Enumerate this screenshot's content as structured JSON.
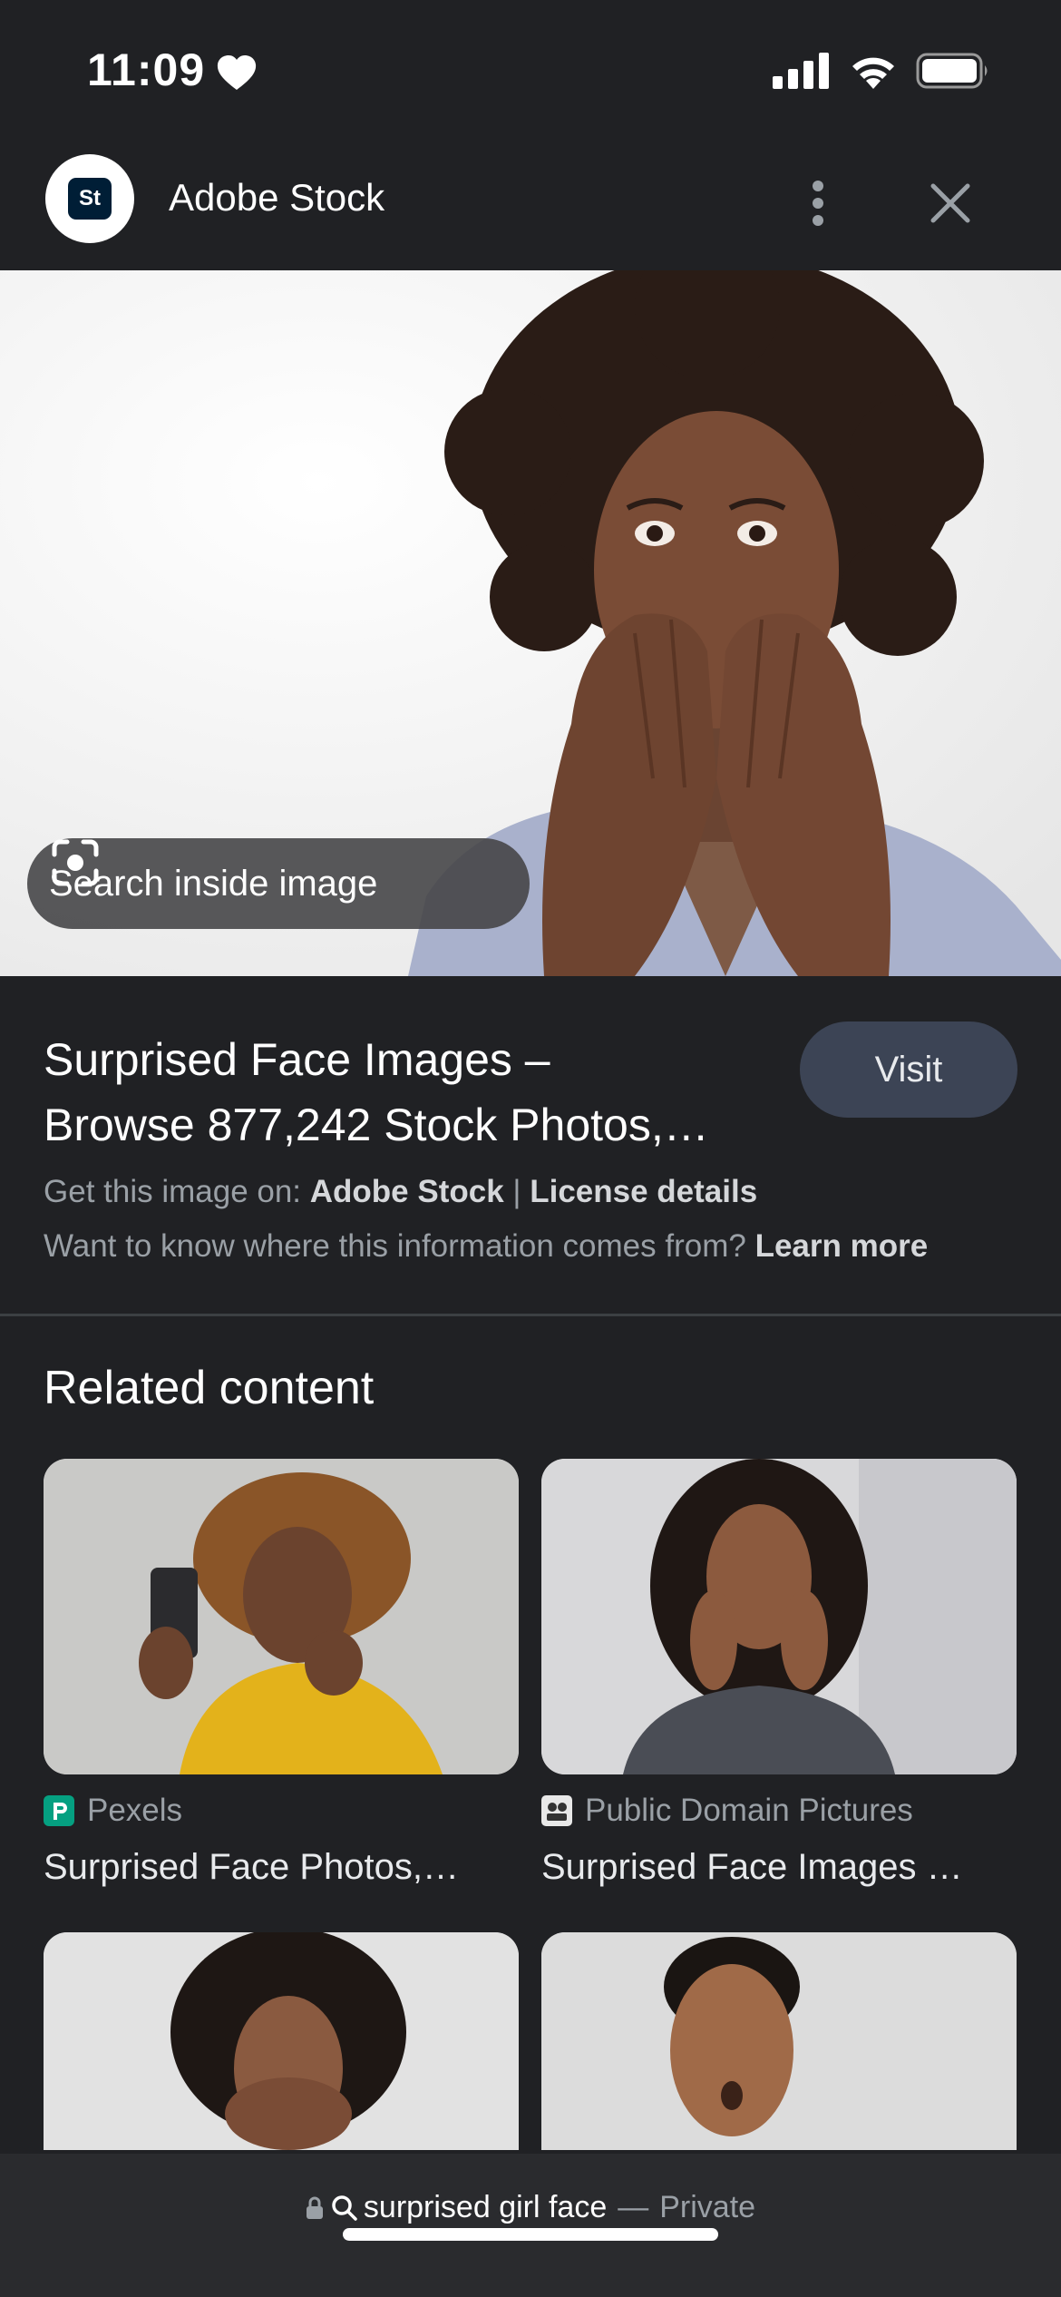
{
  "status_bar": {
    "time": "11:09",
    "icons": [
      "heart-icon",
      "cellular-signal-icon",
      "wifi-icon",
      "battery-icon"
    ]
  },
  "app_bar": {
    "logo_text": "St",
    "title": "Adobe Stock",
    "icons": [
      "more-vert-icon",
      "close-icon"
    ]
  },
  "hero": {
    "lens_label": "Search inside image",
    "icon": "lens-scan-icon"
  },
  "result": {
    "title_line1": "Surprised Face Images –",
    "title_line2": "Browse 877,242 Stock Photos,…",
    "visit_label": "Visit",
    "source_prefix": "Get this image on: ",
    "source_name": "Adobe Stock",
    "separator": " | ",
    "license_label": "License details",
    "info_text": "Want to know where this information comes from? ",
    "learn_more": "Learn more"
  },
  "related": {
    "heading": "Related content",
    "cards": [
      {
        "source": "Pexels",
        "source_icon": "pexels-icon",
        "title": "Surprised Face Photos,…"
      },
      {
        "source": "Public Domain Pictures",
        "source_icon": "public-domain-icon",
        "title": "Surprised Face Images …"
      }
    ]
  },
  "bottom_bar": {
    "query": "surprised girl face",
    "separator": "—",
    "mode": "Private",
    "icons": [
      "lock-icon",
      "search-icon"
    ]
  },
  "colors": {
    "background": "#202124",
    "visit_button": "#3c4455",
    "muted_text": "#9aa0a6"
  }
}
